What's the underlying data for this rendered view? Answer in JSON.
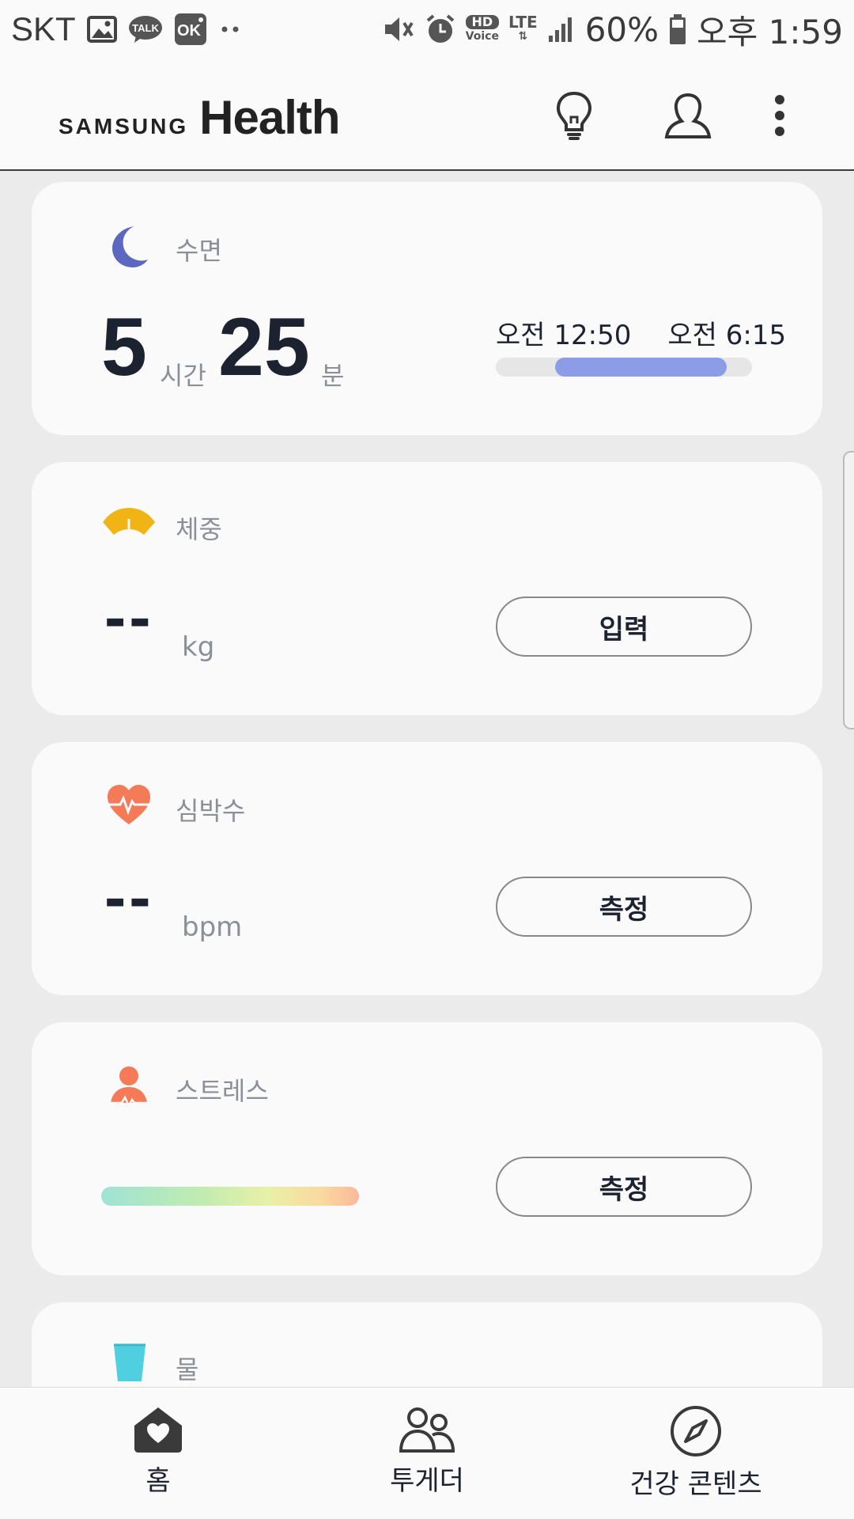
{
  "status_bar": {
    "carrier": "SKT",
    "left_icons": [
      "gallery-icon",
      "kakaotalk-icon",
      "ok-cashbag-icon",
      "more-dots-icon"
    ],
    "talk_badge": "TALK",
    "ok_badge": "OK",
    "right_icons": [
      "mute-icon",
      "alarm-icon",
      "hd-voice-icon",
      "lte-icon",
      "signal-icon",
      "battery-icon"
    ],
    "hd_label": "HD",
    "voice_label": "Voice",
    "lte_label": "LTE",
    "battery": "60%",
    "time": "오후 1:59"
  },
  "header": {
    "brand_samsung": "SAMSUNG",
    "brand_health": "Health",
    "actions": [
      "lightbulb-icon",
      "profile-icon",
      "more-vert-icon"
    ]
  },
  "cards": {
    "sleep": {
      "title": "수면",
      "hours": "5",
      "hours_unit": "시간",
      "minutes": "25",
      "minutes_unit": "분",
      "start_time": "오전 12:50",
      "end_time": "오전 6:15",
      "bar_start_fraction": 0.23,
      "bar_end_fraction": 0.9,
      "bar_color": "#8d9ce6",
      "icon_color": "#5c67c0"
    },
    "weight": {
      "title": "체중",
      "value": "--",
      "unit": "kg",
      "button": "입력",
      "icon_color": "#f0b414"
    },
    "heart_rate": {
      "title": "심박수",
      "value": "--",
      "unit": "bpm",
      "button": "측정",
      "icon_color": "#f47a58"
    },
    "stress": {
      "title": "스트레스",
      "button": "측정",
      "icon_color": "#f47a58"
    },
    "water": {
      "title": "물",
      "icon_color": "#4fcfe0"
    }
  },
  "bottom_nav": {
    "items": [
      {
        "label": "홈",
        "icon": "home-heart-icon"
      },
      {
        "label": "투게더",
        "icon": "together-icon"
      },
      {
        "label": "건강 콘텐츠",
        "icon": "compass-icon"
      }
    ]
  }
}
